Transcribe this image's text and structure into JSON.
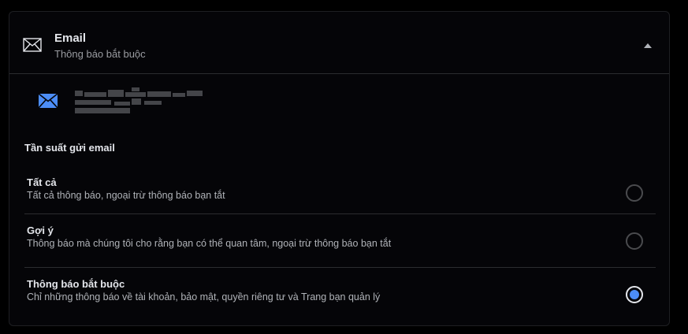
{
  "header": {
    "title": "Email",
    "subtitle": "Thông báo bắt buộc",
    "icon": "envelope-outline-icon",
    "collapse_icon": "caret-up-icon"
  },
  "account": {
    "icon": "envelope-filled-icon",
    "email_obscured": true
  },
  "frequency": {
    "label": "Tần suất gửi email",
    "options": [
      {
        "title": "Tất cả",
        "description": "Tất cả thông báo, ngoại trừ thông báo bạn tắt",
        "selected": false
      },
      {
        "title": "Gợi ý",
        "description": "Thông báo mà chúng tôi cho rằng bạn có thể quan tâm, ngoại trừ thông báo bạn tắt",
        "selected": false
      },
      {
        "title": "Thông báo bắt buộc",
        "description": "Chỉ những thông báo về tài khoản, bảo mật, quyền riêng tư và Trang bạn quản lý",
        "selected": true
      }
    ]
  },
  "colors": {
    "background": "#000000",
    "accent": "#4c8df6",
    "text_primary": "#e4e6eb",
    "text_secondary": "#b0b3b8"
  }
}
